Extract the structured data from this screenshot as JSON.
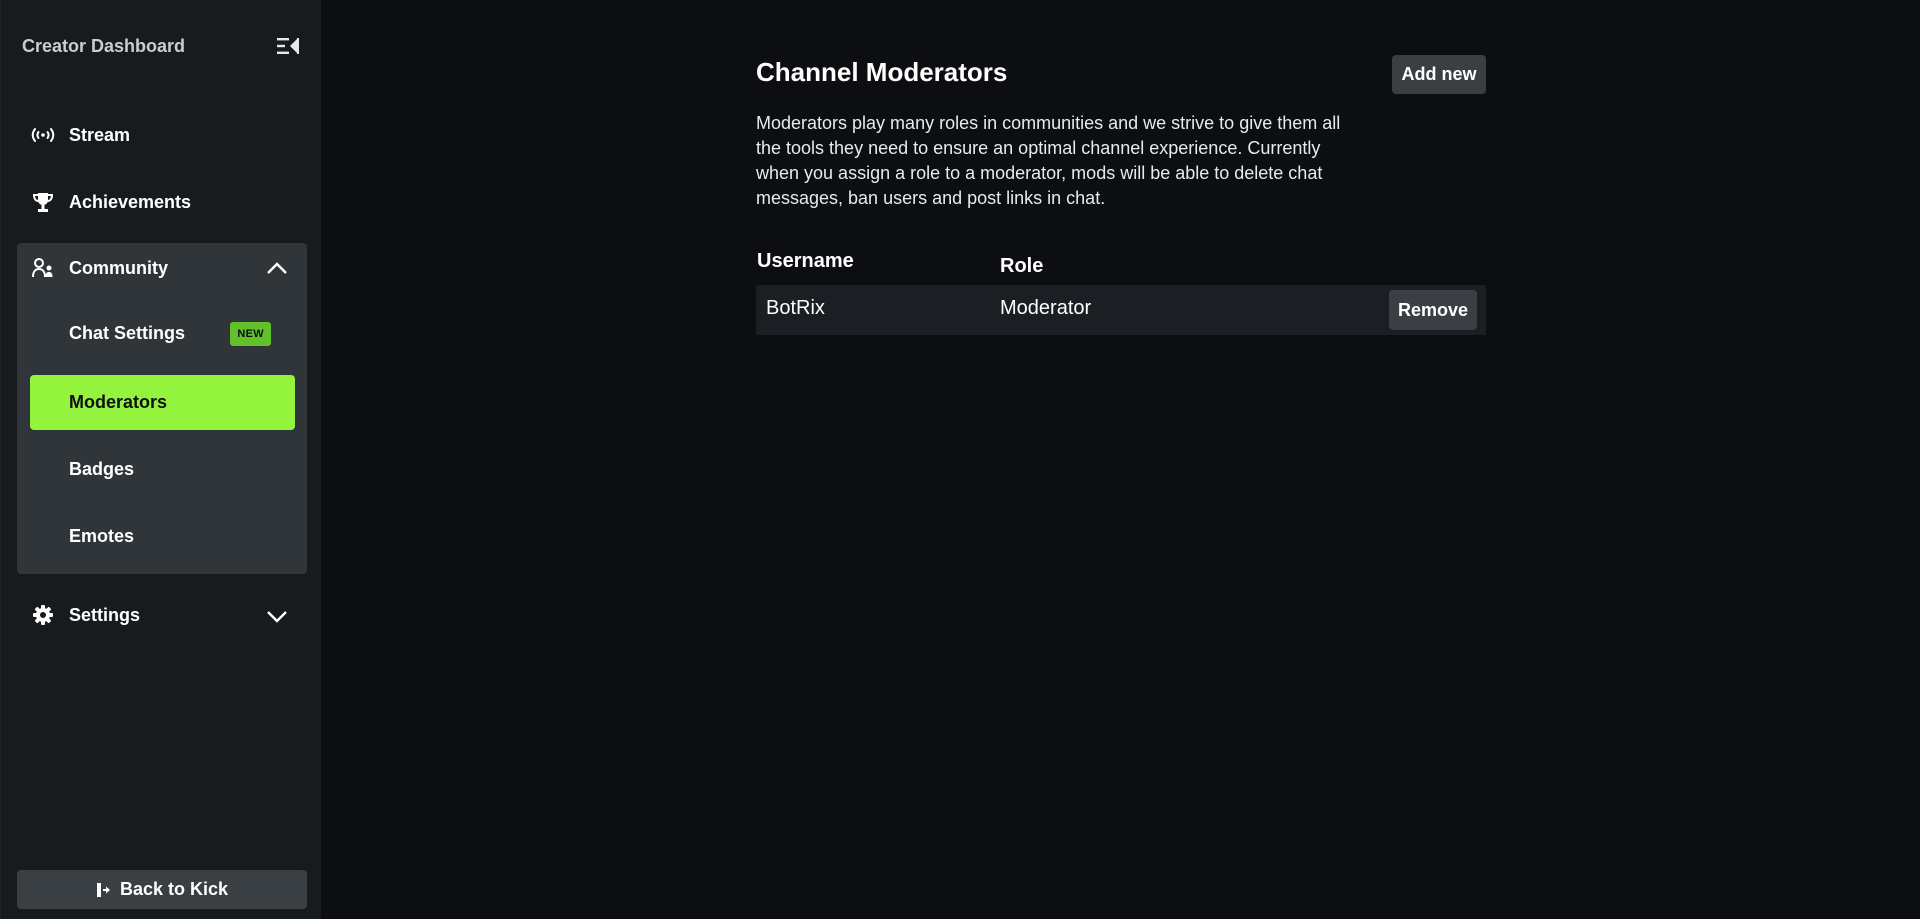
{
  "sidebar": {
    "title": "Creator Dashboard",
    "collapse_icon": "sidebar-collapse-icon",
    "items": [
      {
        "label": "Stream",
        "icon": "broadcast-icon"
      },
      {
        "label": "Achievements",
        "icon": "trophy-icon"
      },
      {
        "label": "Community",
        "icon": "community-icon",
        "expanded": true,
        "children": [
          {
            "label": "Chat Settings",
            "badge": "NEW"
          },
          {
            "label": "Moderators",
            "active": true
          },
          {
            "label": "Badges"
          },
          {
            "label": "Emotes"
          }
        ]
      },
      {
        "label": "Settings",
        "icon": "gear-icon",
        "expanded": false
      }
    ],
    "back_label": "Back to Kick"
  },
  "colors": {
    "accent": "#94f43d",
    "badge": "#62c02a",
    "background": "#0c0e11",
    "sidebar": "#181b1e",
    "button": "#3a3f44"
  },
  "main": {
    "title": "Channel Moderators",
    "add_label": "Add new",
    "description": "Moderators play many roles in communities and we strive to give them all the tools they need to ensure an optimal channel experience. Currently when you assign a role to a moderator, mods will be able to delete chat messages, ban users and post links in chat.",
    "table": {
      "columns": [
        "Username",
        "Role"
      ],
      "rows": [
        {
          "username": "BotRix",
          "role": "Moderator",
          "action": "Remove"
        }
      ]
    }
  }
}
